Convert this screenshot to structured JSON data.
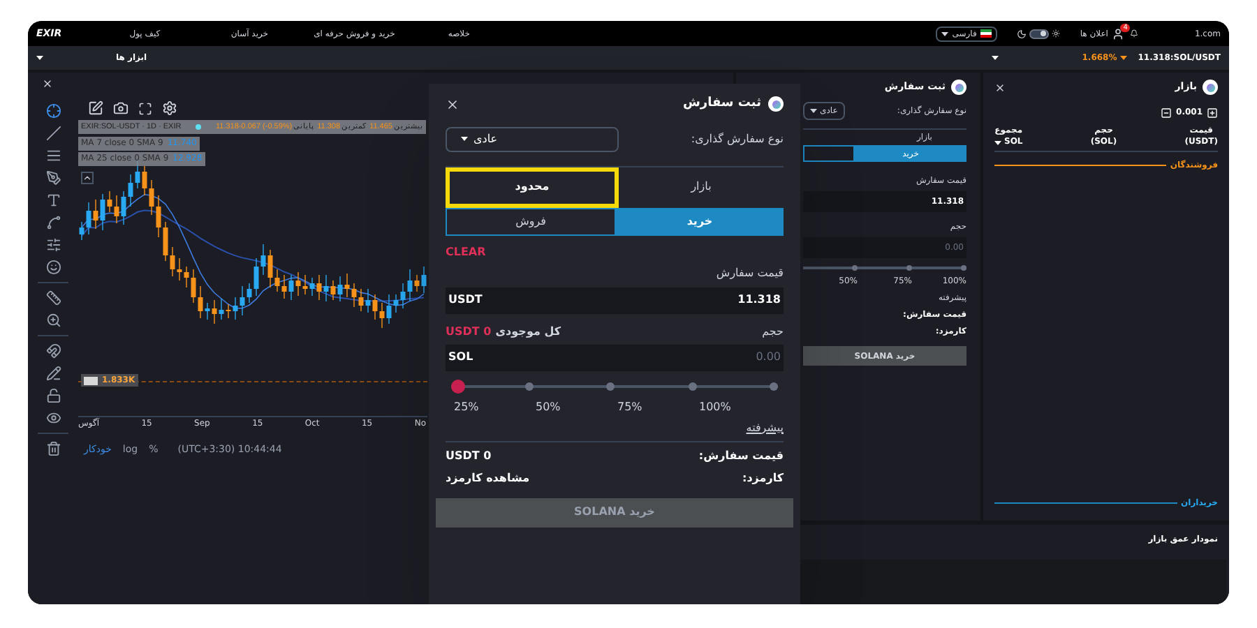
{
  "topbar": {
    "logo": "EXIR",
    "nav": [
      {
        "label": "خلاصه"
      },
      {
        "label": "خرید و فروش حرفه ای"
      },
      {
        "label": "خرید آسان"
      },
      {
        "label": "کیف پول"
      }
    ],
    "language": "فارسی",
    "dark_mode": true,
    "notifications": {
      "label": "اعلان ها",
      "badge": "4"
    },
    "site": "1.com"
  },
  "subbar": {
    "tools": "ابزار ها",
    "pair": "11.318:SOL/USDT",
    "change": "1.668%"
  },
  "chart": {
    "symbol": "EXIR:SOL-USDT · 1D · EXIR",
    "stats": [
      {
        "label": "بیشترین",
        "value": "11.465"
      },
      {
        "label": "کمترین",
        "value": "11.308"
      },
      {
        "label": "پایانی",
        "value": "11.318-0.067 (-0.59%)"
      }
    ],
    "indicators": [
      {
        "label": "MA 7 close 0 SMA 9",
        "value": "11.740"
      },
      {
        "label": "MA 25 close 0 SMA 9",
        "value": "12.928"
      }
    ],
    "volume": "1.833K",
    "x_labels": [
      "No",
      "15",
      "Oct",
      "15",
      "Sep",
      "15",
      "آگوس"
    ],
    "footer": {
      "auto": "خودکار",
      "log": "log",
      "percent": "%",
      "time": "(UTC+3:30) 10:44:44"
    }
  },
  "order_panel": {
    "title": "ثبت سفارش",
    "order_type_label": "نوع سفارش گذاری:",
    "order_type": "عادی",
    "market_tab": "بازار",
    "buy_tab": {
      "label": "خرید",
      "selected": true
    },
    "price_label": "قیمت سفارش",
    "price": "11.318",
    "volume_label": "حجم",
    "volume_placeholder": "0.00",
    "slider": {
      "level": 0
    },
    "ticks": [
      "100%",
      "75%",
      "50%"
    ],
    "advanced": "پیشرفته",
    "summary_labels": [
      "قیمت سفارش:",
      "کارمزد:"
    ],
    "submit": "خرید SOLANA"
  },
  "market_panel": {
    "title": "بازار",
    "step": "0.001",
    "columns": [
      {
        "title": "قیمت",
        "unit": "(USDT)"
      },
      {
        "title": "حجم",
        "unit": "(SOL)"
      },
      {
        "title": "مجموع",
        "unit": "SOL"
      }
    ],
    "sellers": "فروشندگان",
    "buyers": "خریداران"
  },
  "depth_panel": {
    "title": "نمودار عمق بازار"
  },
  "order_dialog": {
    "title": "ثبت سفارش",
    "order_type_label": "نوع سفارش گذاری:",
    "order_type": "عادی",
    "mode_tabs": [
      {
        "label": "بازار",
        "selected": false,
        "highlighted": false
      },
      {
        "label": "محدود",
        "selected": true,
        "highlighted": true
      }
    ],
    "side_tabs": [
      {
        "label": "خرید",
        "selected": true
      },
      {
        "label": "فروش",
        "selected": false
      }
    ],
    "clear": "CLEAR",
    "price_label": "قیمت سفارش",
    "price": {
      "unit": "USDT",
      "value": "11.318"
    },
    "volume_label": "حجم",
    "balance_label": "کل موجودی",
    "balance": "USDT 0",
    "volume": {
      "unit": "SOL",
      "placeholder": "0.00"
    },
    "slider": {
      "level": 0,
      "ticks": [
        "100%",
        "75%",
        "50%",
        "25%"
      ]
    },
    "advanced": "پیشرفته",
    "summary": [
      {
        "label": "قیمت سفارش:",
        "value": "USDT 0"
      },
      {
        "label": "کارمزد:",
        "value": "مشاهده کارمزد"
      }
    ],
    "submit": {
      "label": "خرید SOLANA",
      "disabled": true
    }
  }
}
